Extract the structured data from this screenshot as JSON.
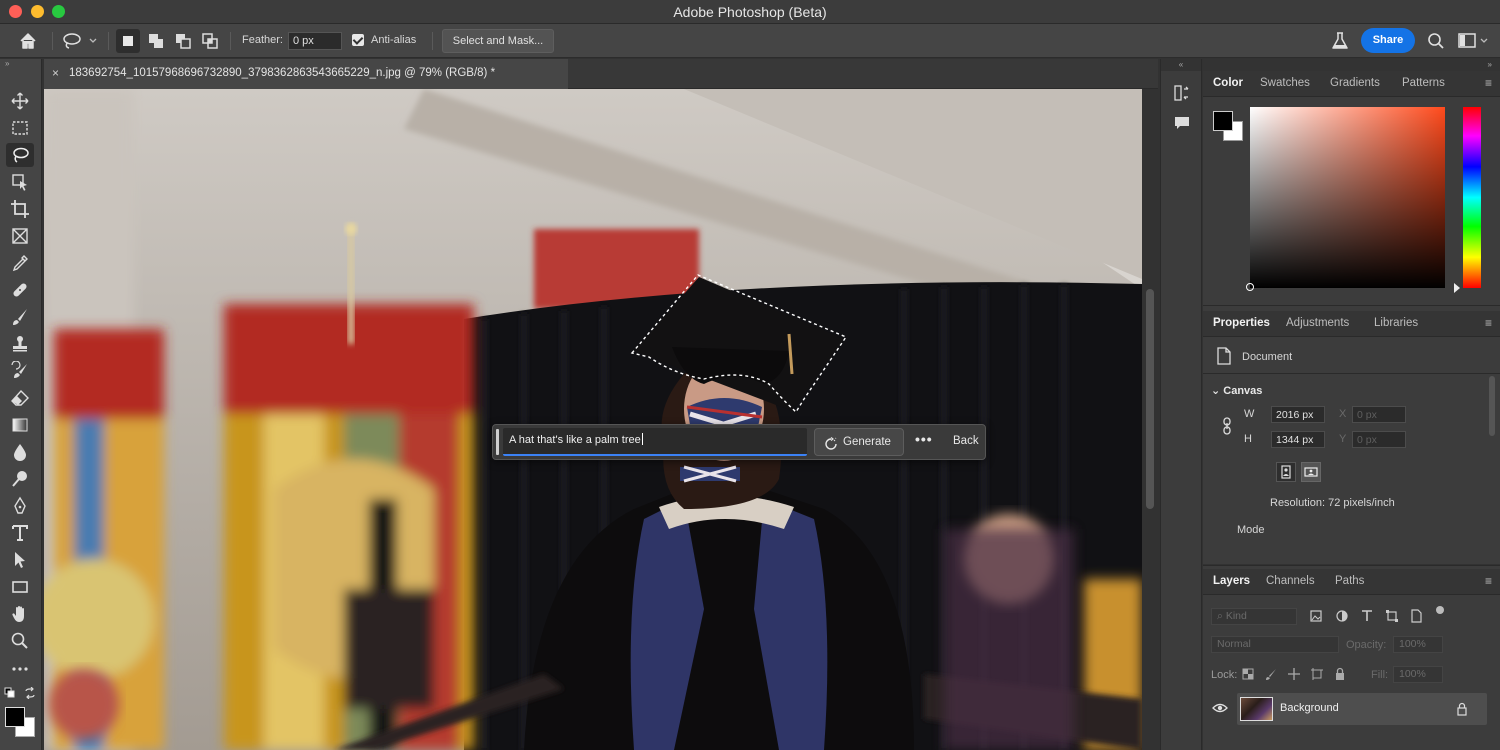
{
  "window": {
    "title": "Adobe Photoshop (Beta)"
  },
  "options": {
    "feather_label": "Feather:",
    "feather_value": "0 px",
    "antialias_label": "Anti-alias",
    "select_mask_label": "Select and Mask...",
    "share_label": "Share"
  },
  "document": {
    "tab_title": "183692754_10157968696732890_3798362863543665229_n.jpg @ 79% (RGB/8) *",
    "close_glyph": "×"
  },
  "taskbar": {
    "prompt": "A hat that's like a palm tree",
    "generate_label": "Generate",
    "more_label": "•••",
    "back_label": "Back"
  },
  "color_panel": {
    "tabs": [
      "Color",
      "Swatches",
      "Gradients",
      "Patterns"
    ],
    "foreground": "#000000",
    "background": "#ffffff"
  },
  "properties_panel": {
    "tabs": [
      "Properties",
      "Adjustments",
      "Libraries"
    ],
    "doc_label": "Document",
    "section": "Canvas",
    "w_label": "W",
    "w_value": "2016 px",
    "h_label": "H",
    "h_value": "1344 px",
    "x_label": "X",
    "x_value": "0 px",
    "y_label": "Y",
    "y_value": "0 px",
    "resolution": "Resolution: 72 pixels/inch",
    "mode_label": "Mode"
  },
  "layers_panel": {
    "tabs": [
      "Layers",
      "Channels",
      "Paths"
    ],
    "kind_label": "Kind",
    "blend_mode": "Normal",
    "opacity_label": "Opacity:",
    "opacity_value": "100%",
    "lock_label": "Lock:",
    "fill_label": "Fill:",
    "fill_value": "100%",
    "layers": [
      {
        "name": "Background",
        "visible": true,
        "locked": true
      }
    ]
  },
  "colors": {
    "accent": "#1473e6",
    "prompt_underline": "#3b82f6"
  }
}
